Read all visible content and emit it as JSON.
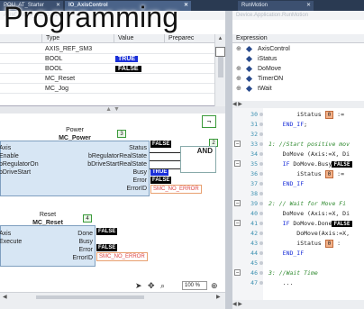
{
  "overlay_title": "Programming",
  "tabs": [
    {
      "label": "POU_AT_Starter",
      "close": "✕"
    },
    {
      "label": "IO_AxisControl",
      "close": "✕"
    },
    {
      "label": "RunMotion",
      "close": "✕"
    }
  ],
  "subbar_left": "AxisCont.IO_AxisControl",
  "subbar_right": "Device.Application.RunMotion",
  "var_table": {
    "columns": [
      "Type",
      "Value",
      "Preparec"
    ],
    "rows": [
      {
        "type": "AXIS_REF_SM3",
        "value": "",
        "value_style": "none"
      },
      {
        "type": "BOOL",
        "value": "TRUE",
        "value_style": "true"
      },
      {
        "type": "BOOL",
        "value": "FALSE",
        "value_style": "false"
      },
      {
        "type": "MC_Reset",
        "value": "",
        "value_style": "none"
      },
      {
        "type": "MC_Jog",
        "value": "",
        "value_style": "none"
      }
    ]
  },
  "fbd": {
    "power_block": {
      "instance": "Power",
      "type": "MC_Power",
      "exec_num": "3",
      "inputs": [
        "Axis",
        "Enable",
        "bRegulatorOn",
        "bDriveStart"
      ],
      "outputs": [
        "Status",
        "bRegulatorRealState",
        "bDriveStartRealState",
        "Busy",
        "Error",
        "ErrorID"
      ],
      "output_values": [
        "FALSE",
        "",
        "",
        "TRUE",
        "FALSE",
        "SMC_NO_ERROR"
      ]
    },
    "and_block": {
      "label": "AND",
      "exec_num": "2"
    },
    "reset_block": {
      "instance": "Reset",
      "type": "MC_Reset",
      "exec_num": "4",
      "inputs": [
        "Axis",
        "Execute"
      ],
      "outputs": [
        "Done",
        "Busy",
        "Error",
        "ErrorID"
      ],
      "output_values": [
        "FALSE",
        "",
        "FALSE",
        "SMC_NO_ERROR"
      ]
    },
    "zoom": "100 %",
    "corner_button": "¬"
  },
  "watch": {
    "header": "Expression",
    "rows": [
      {
        "expand": "⊕",
        "name": "AxisControl"
      },
      {
        "expand": "",
        "name": "iStatus"
      },
      {
        "expand": "⊕",
        "name": "DoMove"
      },
      {
        "expand": "⊕",
        "name": "TimerON"
      },
      {
        "expand": "⊕",
        "name": "tWait"
      }
    ]
  },
  "code": [
    {
      "ln": "30",
      "fold": "",
      "text": "        iStatus",
      "ov": "0",
      "rest": " :="
    },
    {
      "ln": "31",
      "fold": "",
      "kw": "END_IF",
      "text": "    ",
      "rest": ";"
    },
    {
      "ln": "32",
      "fold": "",
      "text": ""
    },
    {
      "ln": "33",
      "fold": "⊟",
      "cm": "1: //Start positive mov"
    },
    {
      "ln": "34",
      "fold": "",
      "text": "    DoMove (Axis:=X, Di"
    },
    {
      "ln": "35",
      "fold": "⊟",
      "kw": "IF",
      "text": "    ",
      "rest": " DoMove.Busy",
      "ovf": "FALSE"
    },
    {
      "ln": "36",
      "fold": "",
      "text": "        iStatus",
      "ov": "0",
      "rest": " :="
    },
    {
      "ln": "37",
      "fold": "",
      "kw": "END_IF",
      "text": "    ",
      "rest": ""
    },
    {
      "ln": "38",
      "fold": "",
      "text": ""
    },
    {
      "ln": "39",
      "fold": "⊟",
      "cm": "2: // Wait for Move Fi"
    },
    {
      "ln": "40",
      "fold": "",
      "text": "    DoMove (Axis:=X, Di"
    },
    {
      "ln": "41",
      "fold": "⊟",
      "kw": "IF",
      "text": "    ",
      "rest": " DoMove.Done",
      "ovf": "FALSE"
    },
    {
      "ln": "42",
      "fold": "",
      "text": "        DoMove(Axis:=X,"
    },
    {
      "ln": "43",
      "fold": "",
      "text": "        iStatus",
      "ov": "0",
      "rest": " :"
    },
    {
      "ln": "44",
      "fold": "",
      "kw": "END_IF",
      "text": "    ",
      "rest": ""
    },
    {
      "ln": "45",
      "fold": "",
      "text": ""
    },
    {
      "ln": "46",
      "fold": "⊟",
      "cm": "3: //Wait Time"
    },
    {
      "ln": "47",
      "fold": "",
      "text": "    ..."
    }
  ],
  "colors": {
    "accent_true": "#1a2fd8",
    "false_bg": "#000000",
    "block_fill": "#d7e6f4",
    "exec_green": "#3a9a3a"
  }
}
